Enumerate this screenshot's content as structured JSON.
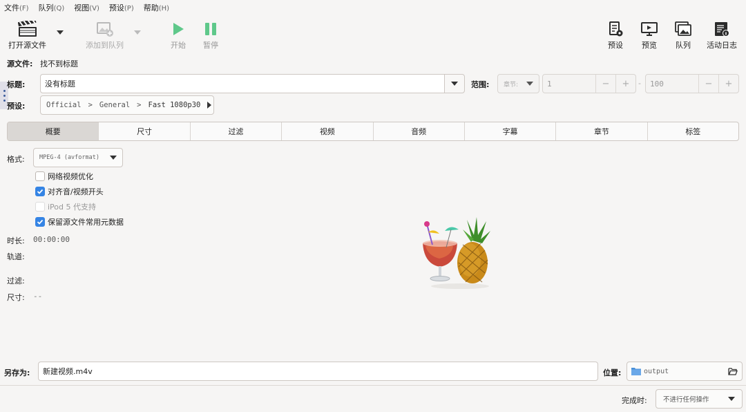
{
  "menu": [
    {
      "label": "文件",
      "accel": "(F)"
    },
    {
      "label": "队列",
      "accel": "(Q)"
    },
    {
      "label": "视图",
      "accel": "(V)"
    },
    {
      "label": "预设",
      "accel": "(P)"
    },
    {
      "label": "帮助",
      "accel": "(H)"
    }
  ],
  "toolbar": {
    "open_source": "打开源文件",
    "add_to_queue": "添加到队列",
    "start": "开始",
    "pause": "暂停",
    "presets": "预设",
    "preview": "预览",
    "queue": "队列",
    "activity_log": "活动日志"
  },
  "source": {
    "label": "源文件:",
    "value": "找不到标题"
  },
  "title": {
    "label": "标题:",
    "value": "没有标题"
  },
  "range": {
    "label": "范围:",
    "mode": "章节:",
    "start": "1",
    "separator": "-",
    "end": "100",
    "minus": "−",
    "plus": "+"
  },
  "preset": {
    "label": "预设:",
    "path": [
      "Official",
      ">",
      "General",
      ">",
      "Fast 1080p30"
    ]
  },
  "tabs": [
    "概要",
    "尺寸",
    "过滤",
    "视频",
    "音频",
    "字幕",
    "章节",
    "标签"
  ],
  "summary": {
    "format_label": "格式:",
    "format_value": "MPEG-4 (avformat)",
    "checkboxes": [
      {
        "label": "网络视频优化",
        "checked": false
      },
      {
        "label": "对齐音/视频开头",
        "checked": true
      },
      {
        "label": "iPod 5 代支持",
        "checked": false
      },
      {
        "label": "保留源文件常用元数据",
        "checked": true
      }
    ],
    "duration_label": "时长:",
    "duration_value": "00:00:00",
    "tracks_label": "轨道:",
    "filters_label": "过滤:",
    "size_label": "尺寸:",
    "size_value": "--"
  },
  "save": {
    "label": "另存为:",
    "filename": "新建视频.m4v",
    "location_label": "位置:",
    "folder": "output"
  },
  "finish": {
    "label": "完成时:",
    "value": "不进行任何操作"
  },
  "colors": {
    "accent": "#3584e4",
    "play_green": "#5fc88a",
    "folder_blue": "#4a90d9"
  }
}
